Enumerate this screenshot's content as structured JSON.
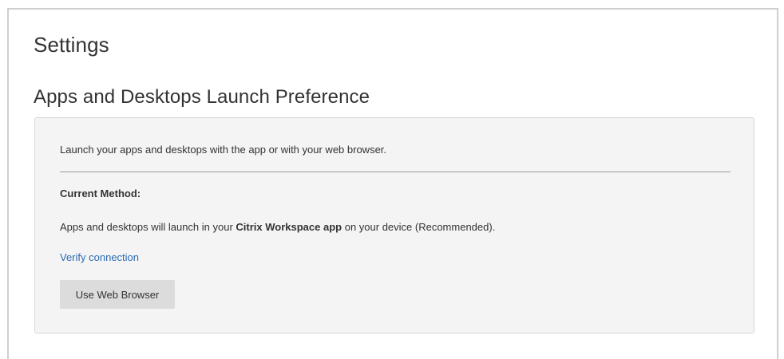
{
  "page": {
    "title": "Settings"
  },
  "launch_preference": {
    "heading": "Apps and Desktops Launch Preference",
    "description": "Launch your apps and desktops with the app or with your web browser.",
    "current_method_label": "Current Method:",
    "method_text_prefix": "Apps and desktops will launch in your ",
    "method_text_app": "Citrix Workspace app",
    "method_text_suffix": " on your device (Recommended).",
    "verify_link": "Verify connection",
    "switch_button": "Use Web Browser"
  }
}
